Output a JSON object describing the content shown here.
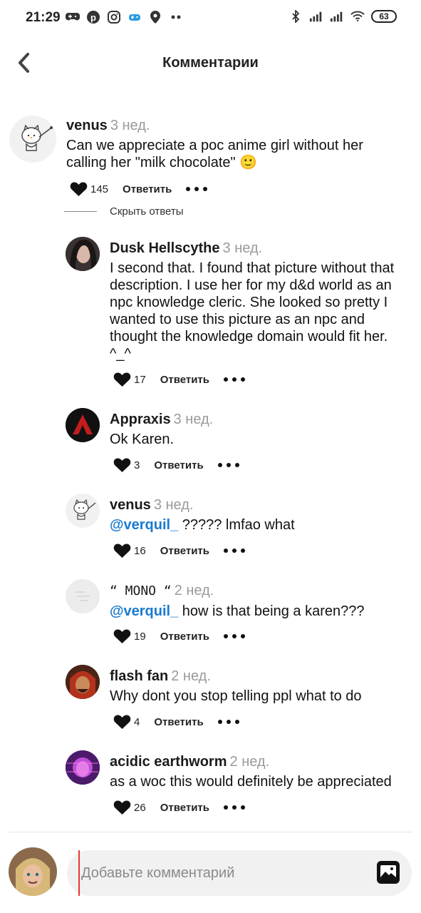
{
  "status_bar": {
    "time": "21:29",
    "battery": "63"
  },
  "header": {
    "title": "Комментарии"
  },
  "reply_label": "Ответить",
  "hide_replies_label": "Скрыть ответы",
  "comments": [
    {
      "user": "venus",
      "time": "3 нед.",
      "text": "Can we appreciate a poc anime girl without her calling her \"milk chocolate\" 🙂",
      "likes": "145"
    },
    {
      "user": "Dusk Hellscythe",
      "time": "3 нед.",
      "text": "I second that. I found that picture without that description. I use her for my d&d world as an npc knowledge cleric. She looked so pretty I wanted to use this picture as an npc and thought the knowledge domain would fit her. ^_^",
      "likes": "17"
    },
    {
      "user": "Appraxis",
      "time": "3 нед.",
      "text": "Ok Karen.",
      "likes": "3"
    },
    {
      "user": "venus",
      "time": "3 нед.",
      "mention": "@verquil_",
      "text": " ????? lmfao what",
      "likes": "16"
    },
    {
      "user": "“ MONO “",
      "time": "2 нед.",
      "mention": "@verquil_",
      "text": " how is that being a karen???",
      "likes": "19"
    },
    {
      "user": "flash fan",
      "time": "2 нед.",
      "text": "Why dont you stop telling ppl what to do",
      "likes": "4"
    },
    {
      "user": "acidic earthworm",
      "time": "2 нед.",
      "text": "as a woc this would definitely be appreciated",
      "likes": "26"
    }
  ],
  "composer": {
    "placeholder": "Добавьте комментарий"
  },
  "colors": {
    "mention": "#1a7ad0",
    "timestamp": "#9a9a9a",
    "cursor": "#e53935"
  }
}
